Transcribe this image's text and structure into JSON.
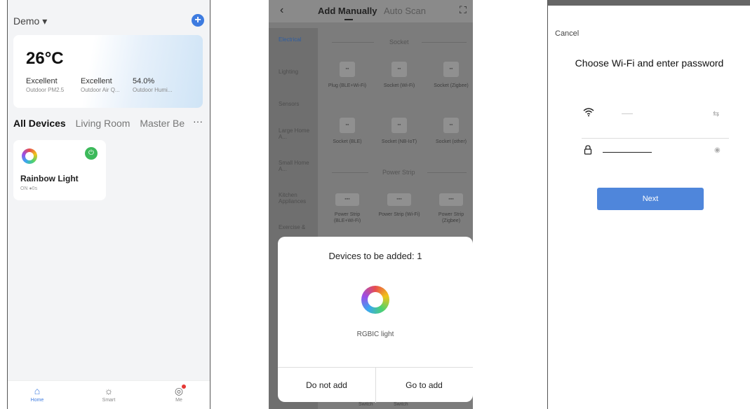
{
  "phone1": {
    "header_title": "Demo ▾",
    "add_icon": "plus-circle-icon",
    "weather": {
      "temperature": "26°C",
      "metrics": [
        {
          "value": "Excellent",
          "label": "Outdoor PM2.5"
        },
        {
          "value": "Excellent",
          "label": "Outdoor Air Q..."
        },
        {
          "value": "54.0%",
          "label": "Outdoor Humi..."
        }
      ]
    },
    "tabs": [
      "All Devices",
      "Living Room",
      "Master Be"
    ],
    "tabs_more": "···",
    "device": {
      "name": "Rainbow Light",
      "status": "ON ●0s"
    },
    "nav": [
      {
        "label": "Home",
        "icon": "home-icon"
      },
      {
        "label": "Smart",
        "icon": "sun-icon"
      },
      {
        "label": "Me",
        "icon": "person-icon"
      }
    ],
    "accent_color": "#3d7be0"
  },
  "phone2": {
    "back": "‹",
    "tab_active": "Add Manually",
    "tab_inactive": "Auto Scan",
    "scan_icon": "scan-icon",
    "categories": [
      "Electrical",
      "Lighting",
      "Sensors",
      "Large Home A...",
      "Small Home A...",
      "Kitchen Appliances",
      "Exercise &"
    ],
    "sections": [
      {
        "title": "Socket",
        "items": [
          "Plug (BLE+Wi-Fi)",
          "Socket (Wi-Fi)",
          "Socket (Zigbee)",
          "Socket (BLE)",
          "Socket (NB-IoT)",
          "Socket (other)"
        ]
      },
      {
        "title": "Power Strip",
        "items": [
          "Power Strip (BLE+Wi-Fi)",
          "Power Strip (Wi-Fi)",
          "Power Strip (Zigbee)"
        ]
      }
    ],
    "bottom_peek": [
      "Switch",
      "Switch"
    ],
    "modal": {
      "title": "Devices to be added: 1",
      "device_name": "RGBIC light",
      "cancel_label": "Do not add",
      "confirm_label": "Go to add"
    }
  },
  "phone3": {
    "cancel": "Cancel",
    "title": "Choose Wi-Fi and enter password",
    "next_label": "Next",
    "accent_color": "#4f86db"
  }
}
